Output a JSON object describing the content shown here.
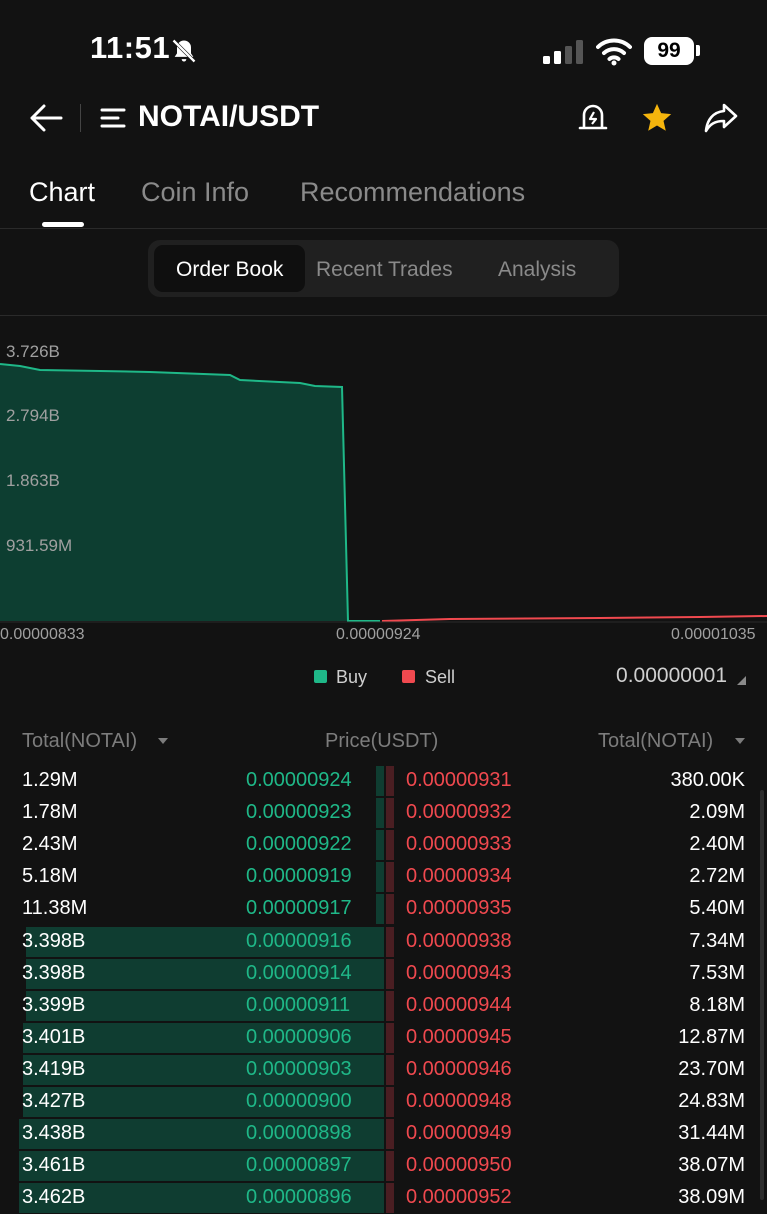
{
  "status_bar": {
    "time": "11:51",
    "battery": "99"
  },
  "header": {
    "title": "NOTAI/USDT"
  },
  "tabs": [
    "Chart",
    "Coin Info",
    "Recommendations"
  ],
  "segments": [
    "Order Book",
    "Recent Trades",
    "Analysis"
  ],
  "depth_chart": {
    "y_labels": [
      "3.726B",
      "2.794B",
      "1.863B",
      "931.59M"
    ],
    "x_labels": [
      "0.00000833",
      "0.00000924",
      "0.00001035"
    ]
  },
  "legend": {
    "buy": "Buy",
    "sell": "Sell",
    "precision": "0.00000001"
  },
  "book_headers": {
    "left": "Total(NOTAI)",
    "middle": "Price(USDT)",
    "right": "Total(NOTAI)"
  },
  "order_book": [
    {
      "bid_total": "1.29M",
      "bid_price": "0.00000924",
      "ask_price": "0.00000931",
      "ask_total": "380.00K",
      "bid_depth": 0.004,
      "ask_depth": 0.003
    },
    {
      "bid_total": "1.78M",
      "bid_price": "0.00000923",
      "ask_price": "0.00000932",
      "ask_total": "2.09M",
      "bid_depth": 0.005,
      "ask_depth": 0.003
    },
    {
      "bid_total": "2.43M",
      "bid_price": "0.00000922",
      "ask_price": "0.00000933",
      "ask_total": "2.40M",
      "bid_depth": 0.006,
      "ask_depth": 0.003
    },
    {
      "bid_total": "5.18M",
      "bid_price": "0.00000919",
      "ask_price": "0.00000934",
      "ask_total": "2.72M",
      "bid_depth": 0.008,
      "ask_depth": 0.003
    },
    {
      "bid_total": "11.38M",
      "bid_price": "0.00000917",
      "ask_price": "0.00000935",
      "ask_total": "5.40M",
      "bid_depth": 0.012,
      "ask_depth": 0.004
    },
    {
      "bid_total": "3.398B",
      "bid_price": "0.00000916",
      "ask_price": "0.00000938",
      "ask_total": "7.34M",
      "bid_depth": 0.98,
      "ask_depth": 0.004
    },
    {
      "bid_total": "3.398B",
      "bid_price": "0.00000914",
      "ask_price": "0.00000943",
      "ask_total": "7.53M",
      "bid_depth": 0.98,
      "ask_depth": 0.004
    },
    {
      "bid_total": "3.399B",
      "bid_price": "0.00000911",
      "ask_price": "0.00000944",
      "ask_total": "8.18M",
      "bid_depth": 0.98,
      "ask_depth": 0.004
    },
    {
      "bid_total": "3.401B",
      "bid_price": "0.00000906",
      "ask_price": "0.00000945",
      "ask_total": "12.87M",
      "bid_depth": 0.99,
      "ask_depth": 0.005
    },
    {
      "bid_total": "3.419B",
      "bid_price": "0.00000903",
      "ask_price": "0.00000946",
      "ask_total": "23.70M",
      "bid_depth": 0.99,
      "ask_depth": 0.006
    },
    {
      "bid_total": "3.427B",
      "bid_price": "0.00000900",
      "ask_price": "0.00000948",
      "ask_total": "24.83M",
      "bid_depth": 0.99,
      "ask_depth": 0.006
    },
    {
      "bid_total": "3.438B",
      "bid_price": "0.00000898",
      "ask_price": "0.00000949",
      "ask_total": "31.44M",
      "bid_depth": 1.0,
      "ask_depth": 0.007
    },
    {
      "bid_total": "3.461B",
      "bid_price": "0.00000897",
      "ask_price": "0.00000950",
      "ask_total": "38.07M",
      "bid_depth": 1.0,
      "ask_depth": 0.008
    },
    {
      "bid_total": "3.462B",
      "bid_price": "0.00000896",
      "ask_price": "0.00000952",
      "ask_total": "38.09M",
      "bid_depth": 1.0,
      "ask_depth": 0.008
    }
  ],
  "colors": {
    "buy": "#1fb888",
    "sell": "#f0494f",
    "star": "#f5b50d"
  },
  "icons": [
    "bell-muted-icon",
    "signal-icon",
    "wifi-icon",
    "battery-icon",
    "back-arrow-icon",
    "menu-icon",
    "alert-bell-icon",
    "star-icon",
    "share-icon",
    "chevron-down-icon",
    "triangle-icon"
  ]
}
